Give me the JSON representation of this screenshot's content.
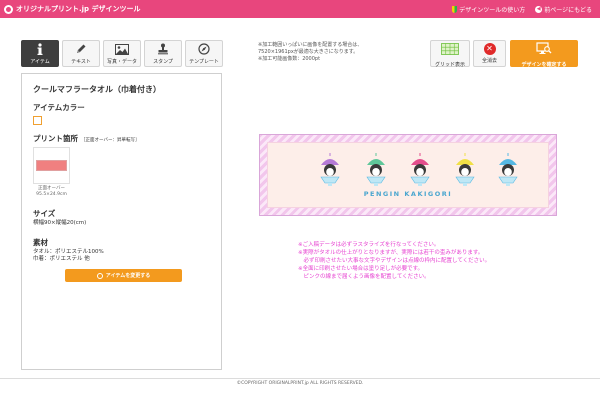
{
  "header": {
    "logo": "オリジナルプリント.jp デザインツール",
    "help_link": "デザインツールの使い方",
    "back_link": "前ページにもどる",
    "back_icon_glyph": "◀"
  },
  "toolbar": {
    "tools": [
      {
        "label": "アイテム",
        "icon": "info-icon",
        "active": true
      },
      {
        "label": "テキスト",
        "icon": "pen-icon",
        "active": false
      },
      {
        "label": "写真・データ",
        "icon": "image-icon",
        "active": false
      },
      {
        "label": "スタンプ",
        "icon": "stamp-icon",
        "active": false
      },
      {
        "label": "テンプレート",
        "icon": "compass-icon",
        "active": false
      }
    ],
    "grid_label": "グリッド表示",
    "clear_label": "全消去",
    "clear_icon_glyph": "✕",
    "confirm_label": "デザインを確定する"
  },
  "notice": {
    "line1": "※加工範囲いっぱいに画像を配置する場合は、",
    "line2": "7520×1961pxが最適な大きさになります。",
    "line3": "※加工可能画像数：2000pt"
  },
  "panel": {
    "item_title": "クールマフラータオル（巾着付き）",
    "color_heading": "アイテムカラー",
    "print_heading": "プリント箇所",
    "print_sub": "［正面オーバー：昇華転写］",
    "thumb_caption1": "正面オーバー",
    "thumb_caption2": "95.5×24.9cm",
    "size_heading": "サイズ",
    "size_value": "横幅90×縦幅20(cm)",
    "material_heading": "素材",
    "material_line1": "タオル：ポリエステル100%",
    "material_line2": "巾着：ポリエステル 他",
    "change_button": "アイテムを変更する"
  },
  "canvas": {
    "design_text": "PENGIN KAKIGORI",
    "colors": {
      "purple": "#b57ad6",
      "green": "#5fc79a",
      "pink": "#e34d8c",
      "yellow": "#f1e046",
      "blue": "#56b8e3"
    }
  },
  "caution": {
    "line1": "※ご入稿データは必ずラスタライズを行なってください。",
    "line2": "※実際がタオルの仕上がりとなりますが、実際には若干の歪みがあります。",
    "line3": "　必ず印刷させたい大事な文字やデザインは点線の枠内に配置してください。",
    "line4": "※全面に印刷させたい場合は塗り足しが必要です。",
    "line5": "　ピンクの線まで届くよう画像を配置してください。"
  },
  "footer": {
    "copyright": "©COPYRIGHT ORIGINALPRINT.jp ALL RIGHTS RESERVED."
  }
}
